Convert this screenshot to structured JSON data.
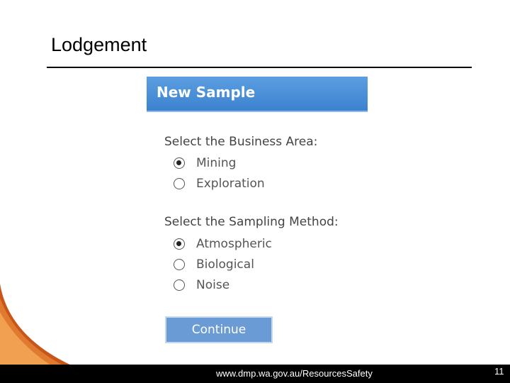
{
  "slide": {
    "title": "Lodgement",
    "footer_url": "www.dmp.wa.gov.au/ResourcesSafety",
    "page_number": "11"
  },
  "form": {
    "header": "New Sample",
    "business_area": {
      "label": "Select the Business Area:",
      "options": [
        {
          "label": "Mining",
          "checked": true
        },
        {
          "label": "Exploration",
          "checked": false
        }
      ]
    },
    "sampling_method": {
      "label": "Select the Sampling Method:",
      "options": [
        {
          "label": "Atmospheric",
          "checked": true
        },
        {
          "label": "Biological",
          "checked": false
        },
        {
          "label": "Noise",
          "checked": false
        }
      ]
    },
    "continue_label": "Continue"
  },
  "colors": {
    "header_blue": "#3b82cf",
    "button_blue": "#6a9bd4",
    "swoosh_orange": "#d2691e"
  }
}
